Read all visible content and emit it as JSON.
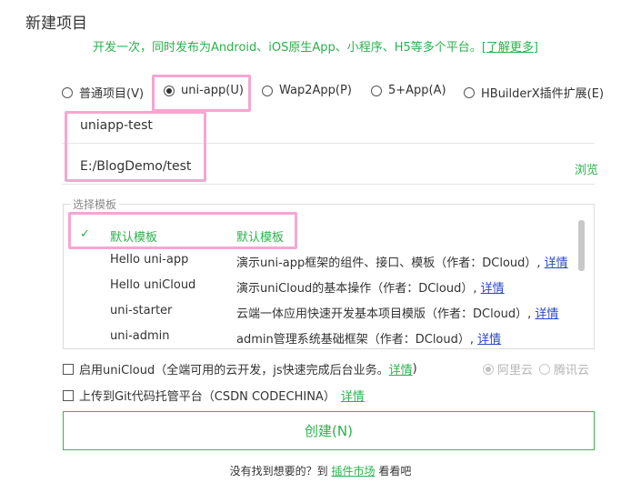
{
  "page": {
    "title": "新建项目",
    "subtitle": "开发一次，同时发布为Android、iOS原生App、小程序、H5等多个平台。",
    "learn_more": "[了解更多]"
  },
  "project_types": [
    {
      "label": "普通项目(V)",
      "checked": false
    },
    {
      "label": "uni-app(U)",
      "checked": true
    },
    {
      "label": "Wap2App(P)",
      "checked": false
    },
    {
      "label": "5+App(A)",
      "checked": false
    },
    {
      "label": "HBuilderX插件扩展(E)",
      "checked": false
    }
  ],
  "form": {
    "project_name": "uniapp-test",
    "location": "E:/BlogDemo/test",
    "browse_label": "浏览"
  },
  "templates": {
    "legend": "选择模板",
    "rows": [
      {
        "name": "默认模板",
        "desc": "默认模板",
        "link": "",
        "selected": true
      },
      {
        "name": "Hello uni-app",
        "desc": "演示uni-app框架的组件、接口、模板（作者：DCloud）,",
        "link": "详情",
        "selected": false
      },
      {
        "name": "Hello uniCloud",
        "desc": "演示uniCloud的基本操作（作者：DCloud）,",
        "link": "详情",
        "selected": false
      },
      {
        "name": "uni-starter",
        "desc": "云端一体应用快速开发基本项目模版（作者：DCloud）,",
        "link": "详情",
        "selected": false
      },
      {
        "name": "uni-admin",
        "desc": "admin管理系统基础框架（作者：DCloud）,",
        "link": "详情",
        "selected": false
      }
    ]
  },
  "options": {
    "unicloud_label": "启用uniCloud（全端可用的云开发，js快速完成后台业务。",
    "unicloud_link": "详情",
    "unicloud_close": ")",
    "provider_aliyun": "阿里云",
    "provider_tencent": "腾讯云",
    "git_label": "上传到Git代码托管平台（CSDN CODECHINA）",
    "git_link": "详情"
  },
  "create_button": "创建(N)",
  "footer": {
    "prefix": "没有找到想要的？到",
    "link": "插件市场",
    "suffix": "看看吧"
  },
  "colors": {
    "accent_green": "#2bb24c",
    "link_blue": "#2a48c9",
    "highlight_pink": "#f6a6d0"
  }
}
